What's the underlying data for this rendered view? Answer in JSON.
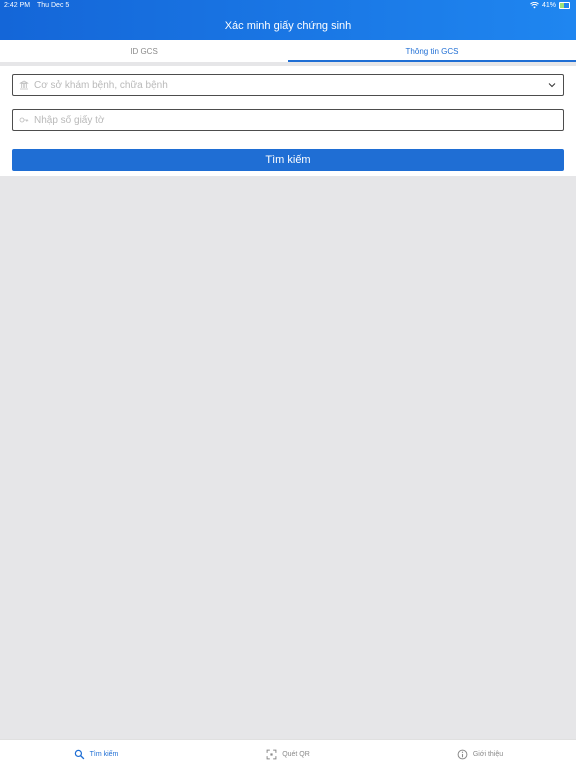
{
  "status_bar": {
    "time": "2:42 PM",
    "date": "Thu Dec 5",
    "battery": "41%",
    "battery_level": 0.41
  },
  "header": {
    "title": "Xác minh giấy chứng sinh"
  },
  "tabs": [
    {
      "label": "ID GCS",
      "active": false
    },
    {
      "label": "Thông tin GCS",
      "active": true
    }
  ],
  "form": {
    "facility_select": {
      "placeholder": "Cơ sở khám bệnh, chữa bệnh",
      "icon": "building-icon"
    },
    "certificate_input": {
      "placeholder": "Nhập số giấy tờ",
      "icon": "key-icon"
    },
    "search_button": "Tìm kiếm"
  },
  "bottom_nav": [
    {
      "label": "Tìm kiếm",
      "icon": "search-icon",
      "active": true
    },
    {
      "label": "Quét QR",
      "icon": "qr-scan-icon",
      "active": false
    },
    {
      "label": "Giới thiệu",
      "icon": "info-icon",
      "active": false
    }
  ],
  "colors": {
    "accent": "#1f6ed4",
    "header_start": "#1466d8",
    "header_end": "#1f86f0",
    "background": "#e6e6e8"
  }
}
